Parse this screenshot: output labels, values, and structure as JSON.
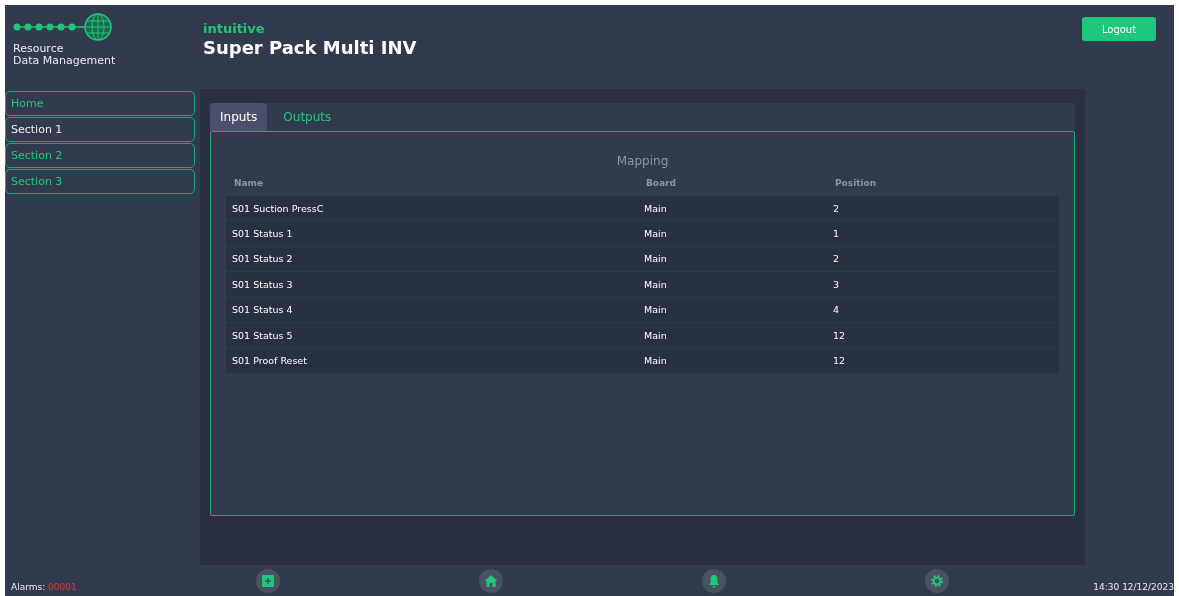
{
  "brand": {
    "line1": "Resource",
    "line2": "Data Management"
  },
  "header": {
    "product": "intuitive",
    "title": "Super Pack Multi INV",
    "logout": "Logout"
  },
  "sidebar": {
    "items": [
      {
        "label": "Home",
        "selected": false
      },
      {
        "label": "Section 1",
        "selected": true
      },
      {
        "label": "Section 2",
        "selected": false
      },
      {
        "label": "Section 3",
        "selected": false
      }
    ]
  },
  "tabs": [
    {
      "label": "Inputs",
      "selected": true
    },
    {
      "label": "Outputs",
      "selected": false
    }
  ],
  "table": {
    "title": "Mapping",
    "columns": [
      "Name",
      "Board",
      "Position"
    ],
    "rows": [
      [
        "S01 Suction PressC",
        "Main",
        "2"
      ],
      [
        "S01 Status 1",
        "Main",
        "1"
      ],
      [
        "S01 Status 2",
        "Main",
        "2"
      ],
      [
        "S01 Status 3",
        "Main",
        "3"
      ],
      [
        "S01 Status 4",
        "Main",
        "4"
      ],
      [
        "S01 Status 5",
        "Main",
        "12"
      ],
      [
        "S01 Proof Reset",
        "Main",
        "12"
      ]
    ]
  },
  "status_bar": {
    "alarms_label": "Alarms:",
    "alarms_count": "00001",
    "time": "14:30 12/12/2023"
  }
}
